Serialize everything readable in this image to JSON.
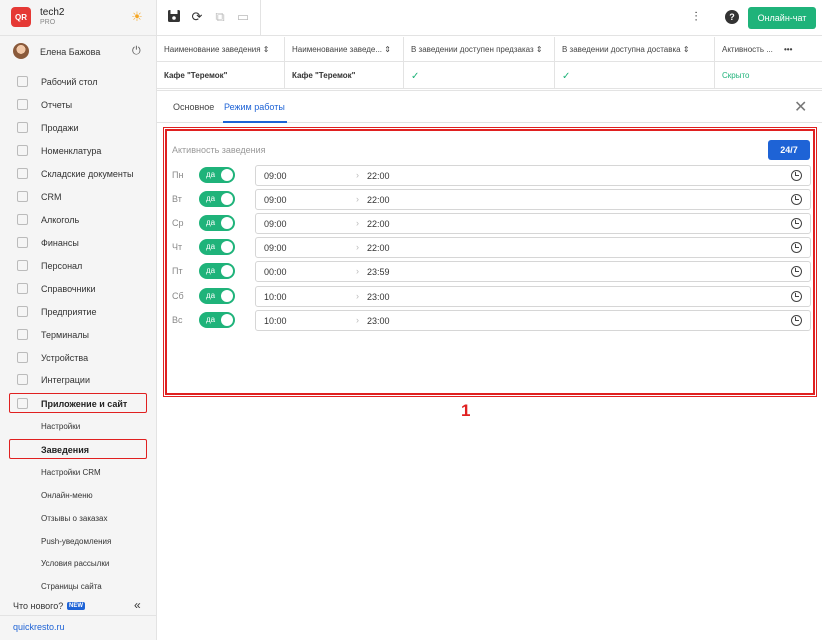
{
  "brand": {
    "name": "tech2",
    "plan": "PRO",
    "logo_text": "QR"
  },
  "user": {
    "name": "Елена Бажова"
  },
  "sidebar": {
    "items": [
      {
        "label": "Рабочий стол"
      },
      {
        "label": "Отчеты"
      },
      {
        "label": "Продажи"
      },
      {
        "label": "Номенклатура"
      },
      {
        "label": "Складские документы"
      },
      {
        "label": "CRM"
      },
      {
        "label": "Алкоголь"
      },
      {
        "label": "Финансы"
      },
      {
        "label": "Персонал"
      },
      {
        "label": "Справочники"
      },
      {
        "label": "Предприятие"
      },
      {
        "label": "Терминалы"
      },
      {
        "label": "Устройства"
      },
      {
        "label": "Интеграции"
      },
      {
        "label": "Приложение и сайт"
      }
    ],
    "subitems": [
      {
        "label": "Настройки"
      },
      {
        "label": "Заведения"
      },
      {
        "label": "Настройки CRM"
      },
      {
        "label": "Онлайн-меню"
      },
      {
        "label": "Отзывы о заказах"
      },
      {
        "label": "Push-уведомления"
      },
      {
        "label": "Условия рассылки"
      },
      {
        "label": "Страницы сайта"
      }
    ],
    "whats_new": "Что нового?",
    "new_badge": "NEW",
    "collapse": "«",
    "site_link": "quickresto.ru"
  },
  "toolbar": {
    "chat_label": "Онлайн-чат",
    "help": "?"
  },
  "table": {
    "columns": [
      "Наименование заведения ⇕",
      "Наименование заведе... ⇕",
      "В заведении доступен предзаказ ⇕",
      "В заведении доступна доставка ⇕",
      "Активность ..."
    ],
    "more": "•••",
    "row": {
      "name1": "Кафе \"Теремок\"",
      "name2": "Кафе \"Теремок\"",
      "preorder": "✓",
      "delivery": "✓",
      "activity": "Скрыто"
    }
  },
  "tabs": {
    "basic": "Основное",
    "schedule": "Режим работы",
    "close": "✕"
  },
  "schedule": {
    "label": "Активность заведения",
    "btn_247": "24/7",
    "toggle_text": "да",
    "arrow": "›",
    "days": [
      {
        "day": "Пн",
        "from": "09:00",
        "to": "22:00"
      },
      {
        "day": "Вт",
        "from": "09:00",
        "to": "22:00"
      },
      {
        "day": "Ср",
        "from": "09:00",
        "to": "22:00"
      },
      {
        "day": "Чт",
        "from": "09:00",
        "to": "22:00"
      },
      {
        "day": "Пт",
        "from": "00:00",
        "to": "23:59"
      },
      {
        "day": "Сб",
        "from": "10:00",
        "to": "23:00"
      },
      {
        "day": "Вс",
        "from": "10:00",
        "to": "23:00"
      }
    ]
  },
  "annotation": {
    "marker": "1"
  }
}
